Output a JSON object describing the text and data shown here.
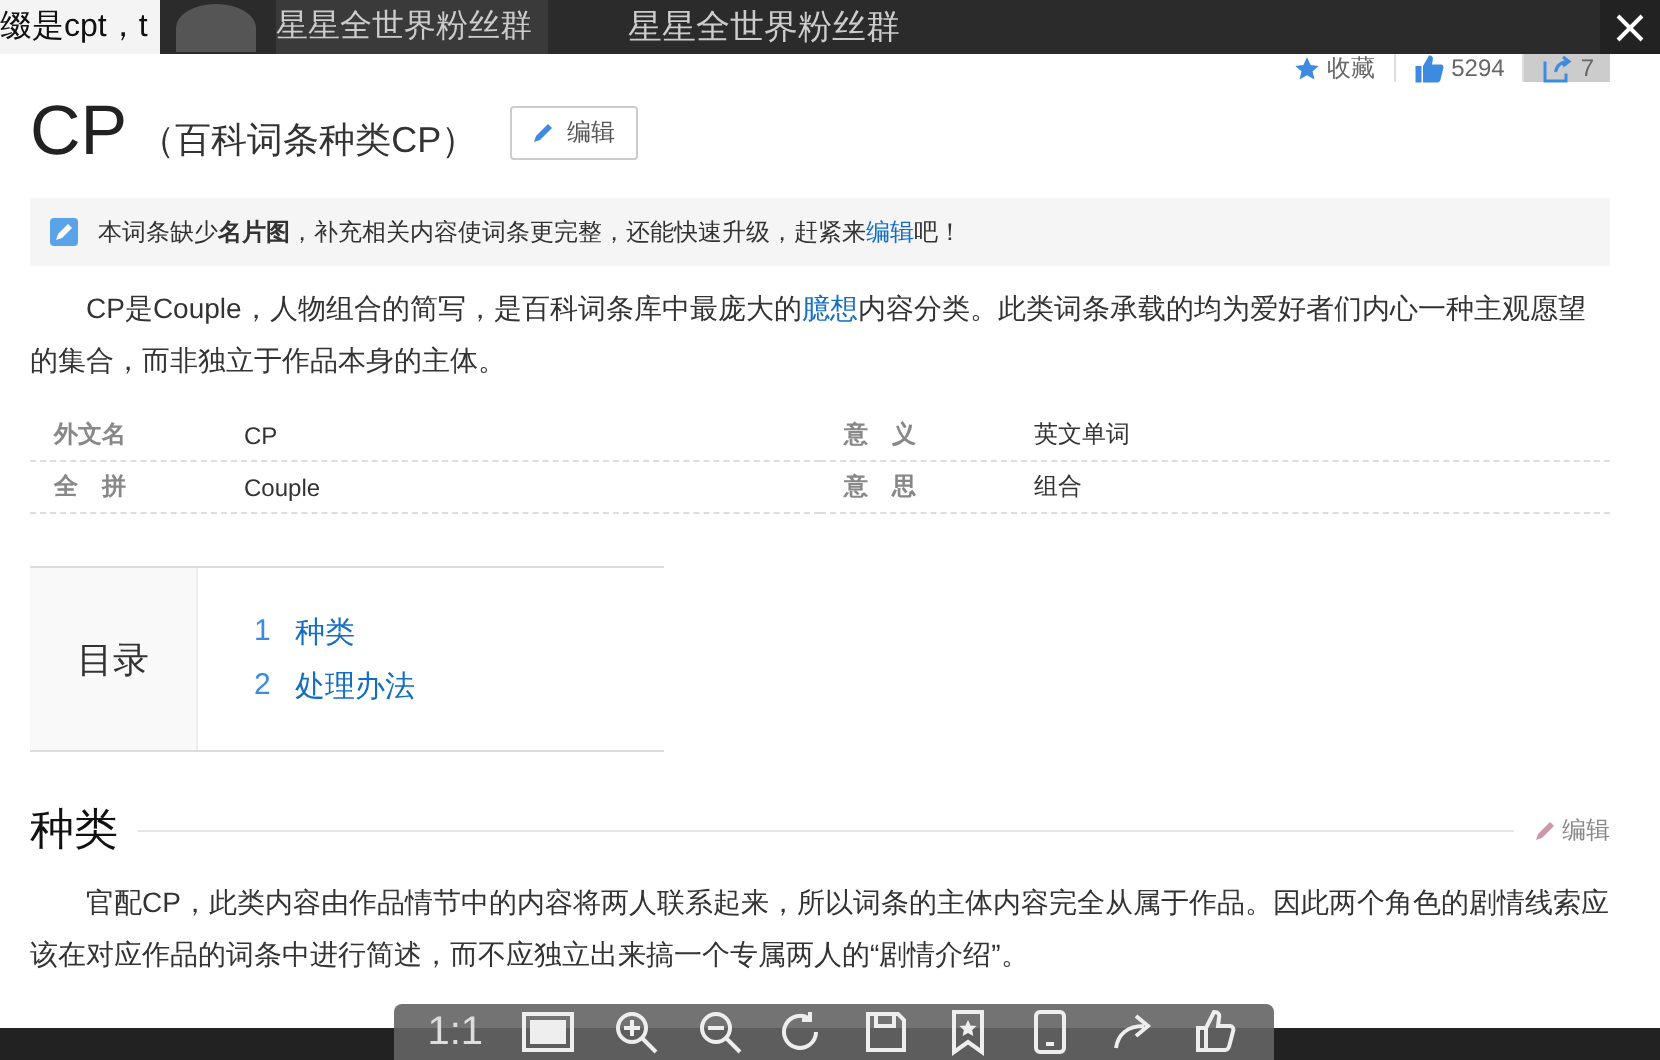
{
  "overlay_bar": {
    "background_text": "缀是cpt，t",
    "group_name": "星星全世界粉丝群",
    "title": "星星全世界粉丝群"
  },
  "actions": {
    "favorite": "收藏",
    "likes": "5294",
    "shares": "7"
  },
  "title": "CP",
  "subtitle": "（百科词条种类CP）",
  "edit_button": "编辑",
  "notice": {
    "before": "本词条缺少**名片图**，补充相关内容使词条更完整，还能快速升级，赶紧来",
    "link": "编辑",
    "after": "吧！"
  },
  "intro": {
    "before": "CP是Couple，人物组合的简写，是百科词条库中最庞大的",
    "link": "臆想",
    "after": "内容分类。此类词条承载的均为爱好者们内心一种主观愿望的集合，而非独立于作品本身的主体。"
  },
  "info": [
    {
      "label": "外文名",
      "value": "CP"
    },
    {
      "label": "意　义",
      "value": "英文单词"
    },
    {
      "label": "全　拼",
      "value": "Couple"
    },
    {
      "label": "意　思",
      "value": "组合"
    }
  ],
  "toc": {
    "title": "目录",
    "items": [
      {
        "number": "1",
        "label": "种类"
      },
      {
        "number": "2",
        "label": "处理办法"
      }
    ]
  },
  "section": {
    "heading": "种类",
    "edit": "编辑",
    "text": "官配CP，此类内容由作品情节中的内容将两人联系起来，所以词条的主体内容完全从属于作品。因此两个角色的剧情线索应该在对应作品的词条中进行简述，而不应独立出来搞一个专属两人的“剧情介绍”。"
  },
  "viewer_toolbar": {
    "ratio": "1:1"
  }
}
